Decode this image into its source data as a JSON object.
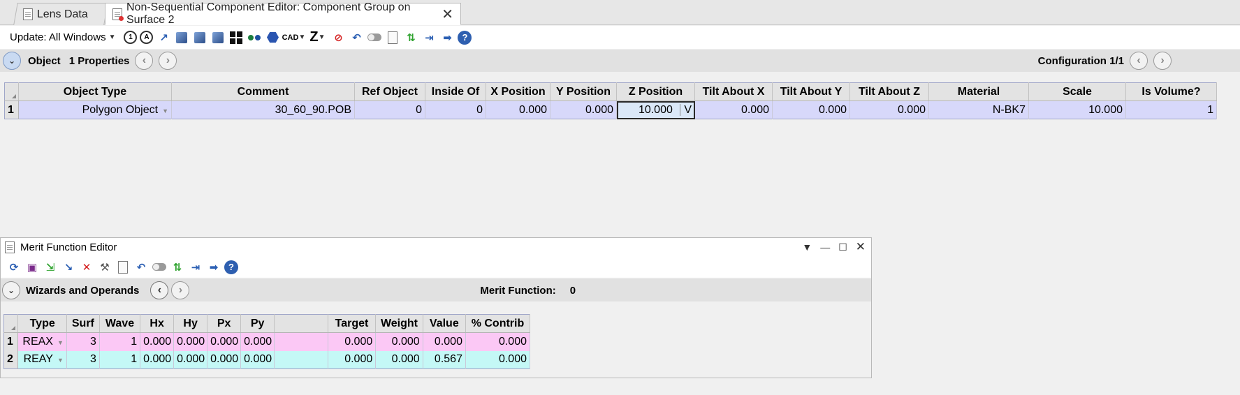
{
  "tabs": [
    {
      "label": "Lens Data"
    },
    {
      "label": "Non-Sequential Component Editor: Component Group on Surface 2"
    }
  ],
  "toolbar": {
    "update_label": "Update: All Windows",
    "cad_label": "CAD",
    "z_label": "Z"
  },
  "nsc_section": {
    "object_label": "Object",
    "properties_label": "1 Properties",
    "configuration_label": "Configuration 1/1"
  },
  "nsc_table": {
    "headers": [
      "Object Type",
      "Comment",
      "Ref Object",
      "Inside Of",
      "X Position",
      "Y Position",
      "Z Position",
      "Tilt About X",
      "Tilt About Y",
      "Tilt About Z",
      "Material",
      "Scale",
      "Is Volume?"
    ],
    "rows": [
      {
        "num": "1",
        "object_type": "Polygon Object",
        "comment": "30_60_90.POB",
        "ref_object": "0",
        "inside_of": "0",
        "x_position": "0.000",
        "y_position": "0.000",
        "z_position": "10.000",
        "z_solve": "V",
        "tilt_x": "0.000",
        "tilt_y": "0.000",
        "tilt_z": "0.000",
        "material": "N-BK7",
        "scale": "10.000",
        "is_volume": "1"
      }
    ]
  },
  "merit_editor": {
    "title": "Merit Function Editor",
    "wizards_label": "Wizards and Operands",
    "merit_function_label": "Merit Function:",
    "merit_function_value": "0",
    "headers": [
      "Type",
      "Surf",
      "Wave",
      "Hx",
      "Hy",
      "Px",
      "Py",
      "",
      "Target",
      "Weight",
      "Value",
      "% Contrib"
    ],
    "rows": [
      {
        "num": "1",
        "type": "REAX",
        "surf": "3",
        "wave": "1",
        "hx": "0.000",
        "hy": "0.000",
        "px": "0.000",
        "py": "0.000",
        "target": "0.000",
        "weight": "0.000",
        "value": "0.000",
        "contrib": "0.000"
      },
      {
        "num": "2",
        "type": "REAY",
        "surf": "3",
        "wave": "1",
        "hx": "0.000",
        "hy": "0.000",
        "px": "0.000",
        "py": "0.000",
        "target": "0.000",
        "weight": "0.000",
        "value": "0.567",
        "contrib": "0.000"
      }
    ]
  },
  "colors": {
    "nsc_row": "#d7d8fa",
    "mf_row_1": "#fbc8f5",
    "mf_row_2": "#c4f8f6",
    "help_icon": "#2e5fb0"
  }
}
